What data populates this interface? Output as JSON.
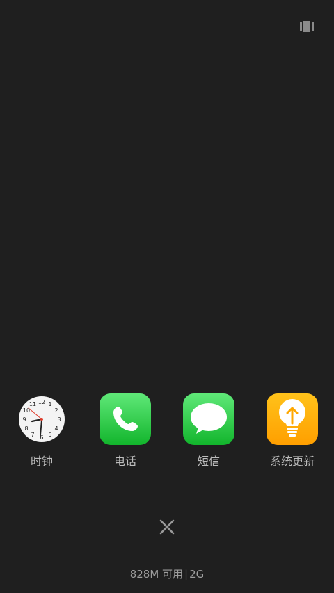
{
  "top_button": {
    "icon": "recent-apps-icon"
  },
  "apps": [
    {
      "label": "时钟",
      "icon": "clock-icon"
    },
    {
      "label": "电话",
      "icon": "phone-icon"
    },
    {
      "label": "短信",
      "icon": "message-icon"
    },
    {
      "label": "系统更新",
      "icon": "lightbulb-update-icon"
    }
  ],
  "clock_face": {
    "numbers": [
      "12",
      "1",
      "2",
      "3",
      "4",
      "5",
      "6",
      "7",
      "8",
      "9",
      "10",
      "11"
    ]
  },
  "close_button": {
    "icon": "close-icon"
  },
  "memory": {
    "available": "828M 可用",
    "total": "2G"
  },
  "colors": {
    "background": "#1f1f1f",
    "phone_green": "#1cc13a",
    "update_orange": "#ffb000"
  }
}
